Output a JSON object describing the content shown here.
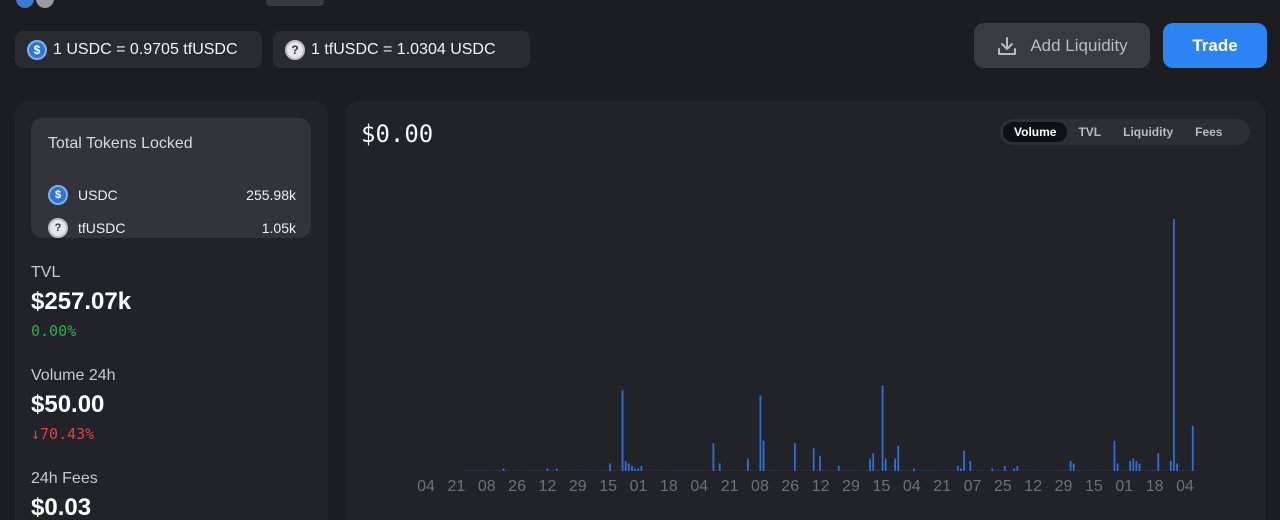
{
  "colors": {
    "accent": "#2b84f2",
    "positive": "#27b04f",
    "negative": "#e0413e",
    "bar": "#2f6fd0"
  },
  "rates": [
    {
      "icon": "usdc-coin-icon",
      "text": "1 USDC = 0.9705 tfUSDC"
    },
    {
      "icon": "question-coin-icon",
      "text": "1 tfUSDC = 1.0304 USDC"
    }
  ],
  "actions": {
    "add_liquidity": "Add Liquidity",
    "trade": "Trade"
  },
  "locked": {
    "title": "Total Tokens Locked",
    "tokens": [
      {
        "symbol": "USDC",
        "amount": "255.98k",
        "icon": "usdc-coin-icon"
      },
      {
        "symbol": "tfUSDC",
        "amount": "1.05k",
        "icon": "question-coin-icon"
      }
    ]
  },
  "stats": {
    "tvl": {
      "label": "TVL",
      "value": "$257.07k",
      "change": "0.00%"
    },
    "volume": {
      "label": "Volume 24h",
      "value": "$50.00",
      "change": "↓70.43%"
    },
    "fees": {
      "label": "24h Fees",
      "value": "$0.03"
    }
  },
  "chart": {
    "value": "$0.00",
    "tabs": [
      "Volume",
      "TVL",
      "Liquidity",
      "Fees"
    ],
    "active_tab": "Volume"
  },
  "chart_data": {
    "type": "bar",
    "xlabel": "",
    "ylabel": "",
    "x_ticks": [
      "04",
      "21",
      "08",
      "26",
      "12",
      "29",
      "15",
      "01",
      "18",
      "04",
      "21",
      "08",
      "26",
      "12",
      "29",
      "15",
      "04",
      "21",
      "07",
      "25",
      "12",
      "29",
      "15",
      "01",
      "18",
      "04"
    ],
    "ylim": [
      0,
      1
    ],
    "values": [
      0,
      0,
      0,
      0,
      0,
      0,
      0,
      0,
      0,
      0,
      0,
      0,
      0.01,
      0,
      0,
      0,
      0,
      0,
      0,
      0,
      0,
      0,
      0,
      0,
      0,
      0,
      0.01,
      0,
      0,
      0.01,
      0,
      0,
      0,
      0,
      0,
      0,
      0,
      0,
      0,
      0,
      0,
      0,
      0,
      0,
      0,
      0,
      0.03,
      0,
      0,
      0,
      0.32,
      0.04,
      0.03,
      0.02,
      0.01,
      0.01,
      0.02,
      0,
      0,
      0,
      0,
      0,
      0,
      0,
      0,
      0,
      0,
      0,
      0,
      0,
      0,
      0,
      0,
      0,
      0,
      0,
      0,
      0,
      0,
      0.11,
      0,
      0.03,
      0,
      0,
      0,
      0,
      0,
      0,
      0,
      0,
      0.05,
      0,
      0,
      0,
      0.3,
      0.12,
      0,
      0,
      0,
      0,
      0,
      0,
      0,
      0,
      0,
      0.11,
      0,
      0,
      0,
      0,
      0,
      0.09,
      0,
      0.06,
      0,
      0,
      0,
      0,
      0,
      0.02,
      0,
      0,
      0,
      0,
      0,
      0,
      0,
      0,
      0,
      0.05,
      0.07,
      0,
      0,
      0.34,
      0.05,
      0,
      0,
      0.05,
      0.1,
      0,
      0,
      0,
      0,
      0.01,
      0,
      0,
      0,
      0,
      0,
      0,
      0,
      0,
      0,
      0,
      0,
      0,
      0,
      0.02,
      0.01,
      0.08,
      0,
      0.04,
      0,
      0,
      0,
      0,
      0,
      0,
      0.01,
      0,
      0,
      0,
      0.02,
      0,
      0,
      0.01,
      0.02,
      0,
      0,
      0,
      0,
      0,
      0,
      0,
      0,
      0,
      0,
      0,
      0,
      0,
      0,
      0,
      0,
      0.04,
      0.03,
      0,
      0,
      0,
      0,
      0,
      0,
      0,
      0,
      0,
      0,
      0,
      0,
      0.12,
      0.03,
      0,
      0,
      0,
      0.04,
      0.05,
      0.04,
      0.03,
      0,
      0,
      0,
      0,
      0,
      0.07,
      0,
      0,
      0,
      0.04,
      1.0,
      0.03,
      0,
      0,
      0,
      0,
      0.18
    ]
  }
}
